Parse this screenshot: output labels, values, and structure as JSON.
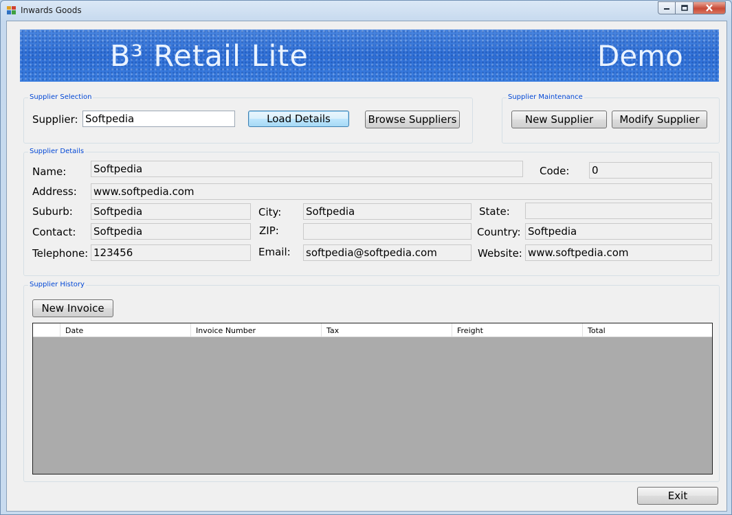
{
  "window": {
    "title": "Inwards Goods",
    "app_icon": "app-icon",
    "minimize_icon": "minimize-icon",
    "maximize_icon": "maximize-icon",
    "close_icon": "close-icon"
  },
  "banner": {
    "title": "B³ Retail Lite",
    "badge": "Demo"
  },
  "supplier_selection": {
    "legend": "Supplier Selection",
    "supplier_label": "Supplier:",
    "supplier_value": "Softpedia",
    "load_button": "Load Details",
    "browse_button": "Browse Suppliers"
  },
  "supplier_maintenance": {
    "legend": "Supplier Maintenance",
    "new_button": "New Supplier",
    "modify_button": "Modify Supplier"
  },
  "supplier_details": {
    "legend": "Supplier Details",
    "name_label": "Name:",
    "name": "Softpedia",
    "code_label": "Code:",
    "code": "0",
    "address_label": "Address:",
    "address": "www.softpedia.com",
    "suburb_label": "Suburb:",
    "suburb": "Softpedia",
    "city_label": "City:",
    "city": "Softpedia",
    "state_label": "State:",
    "state": "",
    "contact_label": "Contact:",
    "contact": "Softpedia",
    "zip_label": "ZIP:",
    "zip": "",
    "country_label": "Country:",
    "country": "Softpedia",
    "telephone_label": "Telephone:",
    "telephone": "123456",
    "email_label": "Email:",
    "email": "softpedia@softpedia.com",
    "website_label": "Website:",
    "website": "www.softpedia.com"
  },
  "supplier_history": {
    "legend": "Supplier History",
    "new_invoice_button": "New Invoice",
    "columns": [
      "Date",
      "Invoice Number",
      "Tax",
      "Freight",
      "Total"
    ]
  },
  "footer": {
    "exit_button": "Exit"
  },
  "colors": {
    "banner": "#2f6fd6",
    "legend": "#0046d5",
    "grid_background": "#ababab"
  }
}
